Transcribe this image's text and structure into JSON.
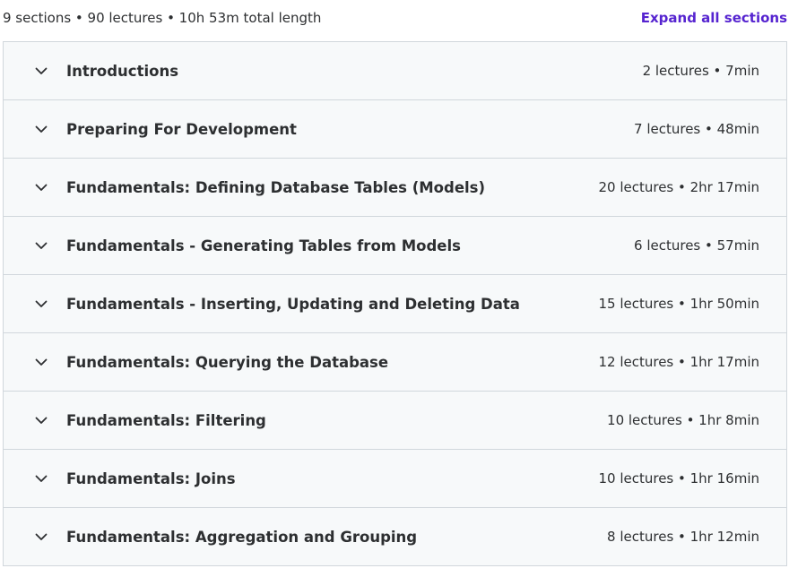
{
  "summary": {
    "text": "9 sections • 90 lectures • 10h 53m total length",
    "expand_label": "Expand all sections"
  },
  "colors": {
    "accent": "#5624d0",
    "row_background": "#f7f9fa",
    "border": "#d1d7dc",
    "text": "#2d2f31"
  },
  "icons": {
    "section_toggle": "chevron-down-icon"
  },
  "sections": [
    {
      "title": "Introductions",
      "meta": "2 lectures • 7min"
    },
    {
      "title": "Preparing For Development",
      "meta": "7 lectures • 48min"
    },
    {
      "title": "Fundamentals: Defining Database Tables (Models)",
      "meta": "20 lectures • 2hr 17min"
    },
    {
      "title": "Fundamentals - Generating Tables from Models",
      "meta": "6 lectures • 57min"
    },
    {
      "title": "Fundamentals - Inserting, Updating and Deleting Data",
      "meta": "15 lectures • 1hr 50min"
    },
    {
      "title": "Fundamentals: Querying the Database",
      "meta": "12 lectures • 1hr 17min"
    },
    {
      "title": "Fundamentals: Filtering",
      "meta": "10 lectures • 1hr 8min"
    },
    {
      "title": "Fundamentals: Joins",
      "meta": "10 lectures • 1hr 16min"
    },
    {
      "title": "Fundamentals: Aggregation and Grouping",
      "meta": "8 lectures • 1hr 12min"
    }
  ]
}
